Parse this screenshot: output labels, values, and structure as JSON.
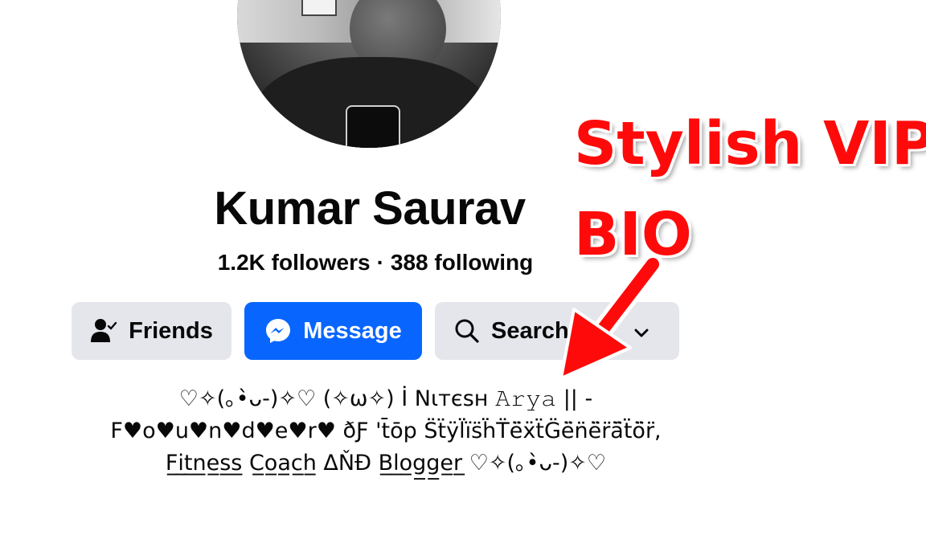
{
  "profile": {
    "name": "Kumar Saurav",
    "followers": "1.2K followers",
    "separator": "·",
    "following": "388 following"
  },
  "actions": {
    "friends_label": "Friends",
    "message_label": "Message",
    "search_label": "Search"
  },
  "bio": {
    "line1": "♡✧(｡•̀ᴗ-)✧♡ (✧ω✧) İ Nιтєѕн 𝙰𝚛𝚢𝚊 ||  -",
    "line2": "F♥o♥u♥n♥d♥e♥r♥ ðƑ ꞌt̄ōp S̈ẗÿl̈ïs̈ḧT̈ë̈ẍẗG̈ë̈n̈ë̈r̈ä̈ẗö̈r̈,",
    "line3": "F̲i̲t̲n̲e̲s̲s̲ C̲o̲a̲c̲h̲ ΔŇĐ B̲l̲o̲g̲g̲e̲r̲ ♡✧(｡•̀ᴗ-)✧♡"
  },
  "annotation": {
    "line1": "Stylish VIP",
    "line2": "BIO",
    "color": "#ff0a0a"
  },
  "icons": {
    "friends": "friend-check-icon",
    "message": "messenger-icon",
    "search": "search-icon",
    "dropdown": "chevron-down-icon"
  },
  "colors": {
    "primary_button": "#0866ff",
    "secondary_button": "#e4e6eb",
    "text": "#080809"
  }
}
